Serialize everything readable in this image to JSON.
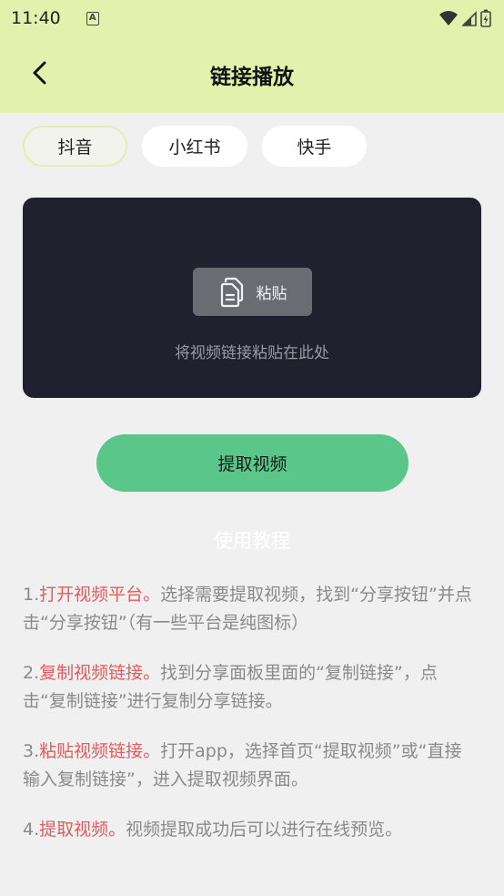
{
  "status_bar": {
    "time": "11:40",
    "notification_icon": "A"
  },
  "header": {
    "title": "链接播放",
    "back_icon": "chevron-left-icon"
  },
  "tabs": [
    {
      "label": "抖音",
      "active": true
    },
    {
      "label": "小红书",
      "active": false
    },
    {
      "label": "快手",
      "active": false
    }
  ],
  "paste_panel": {
    "button_label": "粘贴",
    "button_icon": "paste-icon",
    "hint": "将视频链接粘贴在此处"
  },
  "extract_button": {
    "label": "提取视频"
  },
  "tutorial": {
    "title": "使用教程",
    "steps": [
      {
        "num": "1.",
        "highlight": "打开视频平台。",
        "text": "选择需要提取视频，找到“分享按钮”并点击“分享按钮”（有一些平台是纯图标）"
      },
      {
        "num": "2.",
        "highlight": "复制视频链接。",
        "text": "找到分享面板里面的“复制链接”，点击“复制链接”进行复制分享链接。"
      },
      {
        "num": "3.",
        "highlight": "粘贴视频链接。",
        "text": "打开app，选择首页“提取视频”或“直接输入复制链接”，进入提取视频界面。"
      },
      {
        "num": "4.",
        "highlight": "提取视频。",
        "text": "视频提取成功后可以进行在线预览。"
      }
    ]
  },
  "colors": {
    "header_bg": "#e3f1ad",
    "panel_bg": "#20202e",
    "accent_green": "#5ac68a",
    "highlight_red": "#e35b5b"
  }
}
